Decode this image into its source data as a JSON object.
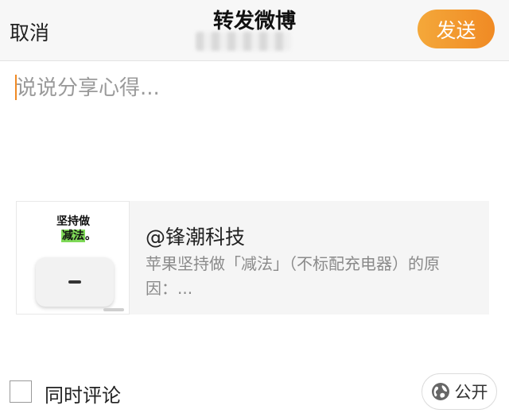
{
  "header": {
    "cancel_label": "取消",
    "title": "转发微博",
    "send_label": "发送"
  },
  "compose": {
    "placeholder": "说说分享心得..."
  },
  "card": {
    "thumb_line1": "坚持做",
    "thumb_line2_highlight": "减法",
    "thumb_line2_suffix": "。",
    "user": "@锋潮科技",
    "text": "苹果坚持做「减法」（不标配充电器）的原因：..."
  },
  "footer": {
    "comment_label": "同时评论",
    "visibility_label": "公开"
  },
  "colors": {
    "accent": "#f08a24",
    "header_bg": "#f7f7f7",
    "card_bg": "#f5f5f5",
    "highlight": "#7ed957"
  },
  "icons": {
    "visibility": "globe-icon",
    "checkbox": "checkbox-unchecked"
  }
}
